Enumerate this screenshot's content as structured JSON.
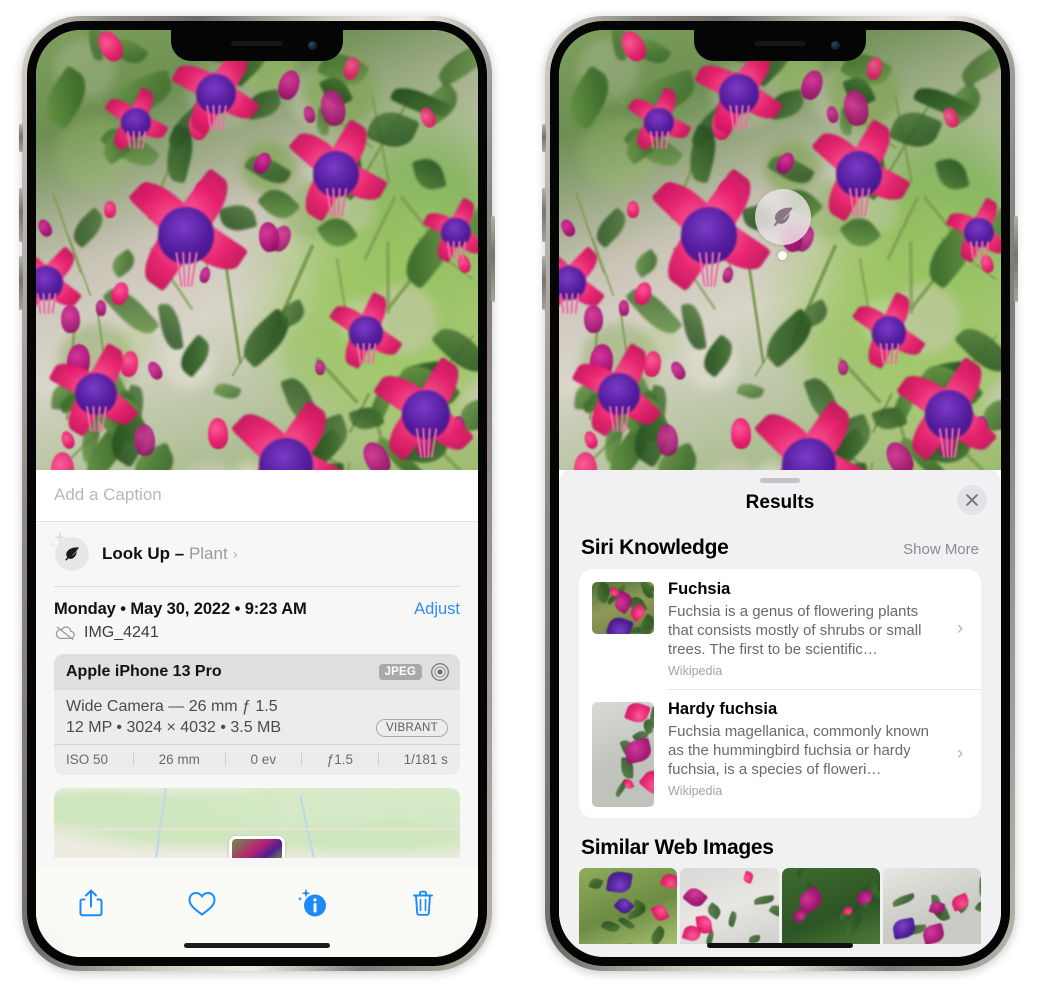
{
  "left_phone": {
    "photo_alt": "fuchsia-flowers-photo",
    "caption_placeholder": "Add a Caption",
    "lookup": {
      "label": "Look Up",
      "separator": "–",
      "subject": "Plant",
      "chevron": "›",
      "icon": "leaf-icon"
    },
    "date": "Monday • May 30, 2022 • 9:23 AM",
    "adjust_label": "Adjust",
    "filename": "IMG_4241",
    "filename_icon": "icloud-slash-icon",
    "camera": {
      "model": "Apple iPhone 13 Pro",
      "format_badge": "JPEG",
      "lens_icon": "aperture-icon",
      "lens_line": "Wide Camera — 26 mm ƒ 1.5",
      "specs_line": "12 MP • 3024 × 4032 • 3.5 MB",
      "style_badge": "VIBRANT",
      "exif": [
        "ISO 50",
        "26 mm",
        "0 ev",
        "ƒ1.5",
        "1/181 s"
      ]
    },
    "toolbar": [
      {
        "name": "share-button",
        "icon": "share-icon"
      },
      {
        "name": "favorite-button",
        "icon": "heart-icon"
      },
      {
        "name": "info-button",
        "icon": "info-sparkle-icon"
      },
      {
        "name": "delete-button",
        "icon": "trash-icon"
      }
    ],
    "accent_color": "#2f8bf5"
  },
  "right_phone": {
    "photo_alt": "fuchsia-flowers-photo",
    "visual_lookup_badge": {
      "icon": "leaf-icon",
      "label": "plant-indicator"
    },
    "sheet": {
      "title": "Results",
      "close_icon": "close-icon",
      "sections": [
        {
          "title": "Siri Knowledge",
          "action_label": "Show More",
          "items": [
            {
              "title": "Fuchsia",
              "description": "Fuchsia is a genus of flowering plants that consists mostly of shrubs or small trees. The first to be scientific…",
              "source": "Wikipedia",
              "thumb": "fuchsia-thumbnail",
              "chevron": "›"
            },
            {
              "title": "Hardy fuchsia",
              "description": "Fuchsia magellanica, commonly known as the hummingbird fuchsia or hardy fuchsia, is a species of floweri…",
              "source": "Wikipedia",
              "thumb": "hardy-fuchsia-thumbnail",
              "chevron": "›"
            }
          ]
        },
        {
          "title": "Similar Web Images",
          "thumbs": [
            "web-image-1",
            "web-image-2",
            "web-image-3",
            "web-image-4"
          ]
        }
      ]
    }
  },
  "colors": {
    "accent": "#2f8bf5",
    "sheet_bg": "#f1f1f4",
    "card_bg": "#ffffff",
    "muted_text": "#8a8a8f"
  }
}
